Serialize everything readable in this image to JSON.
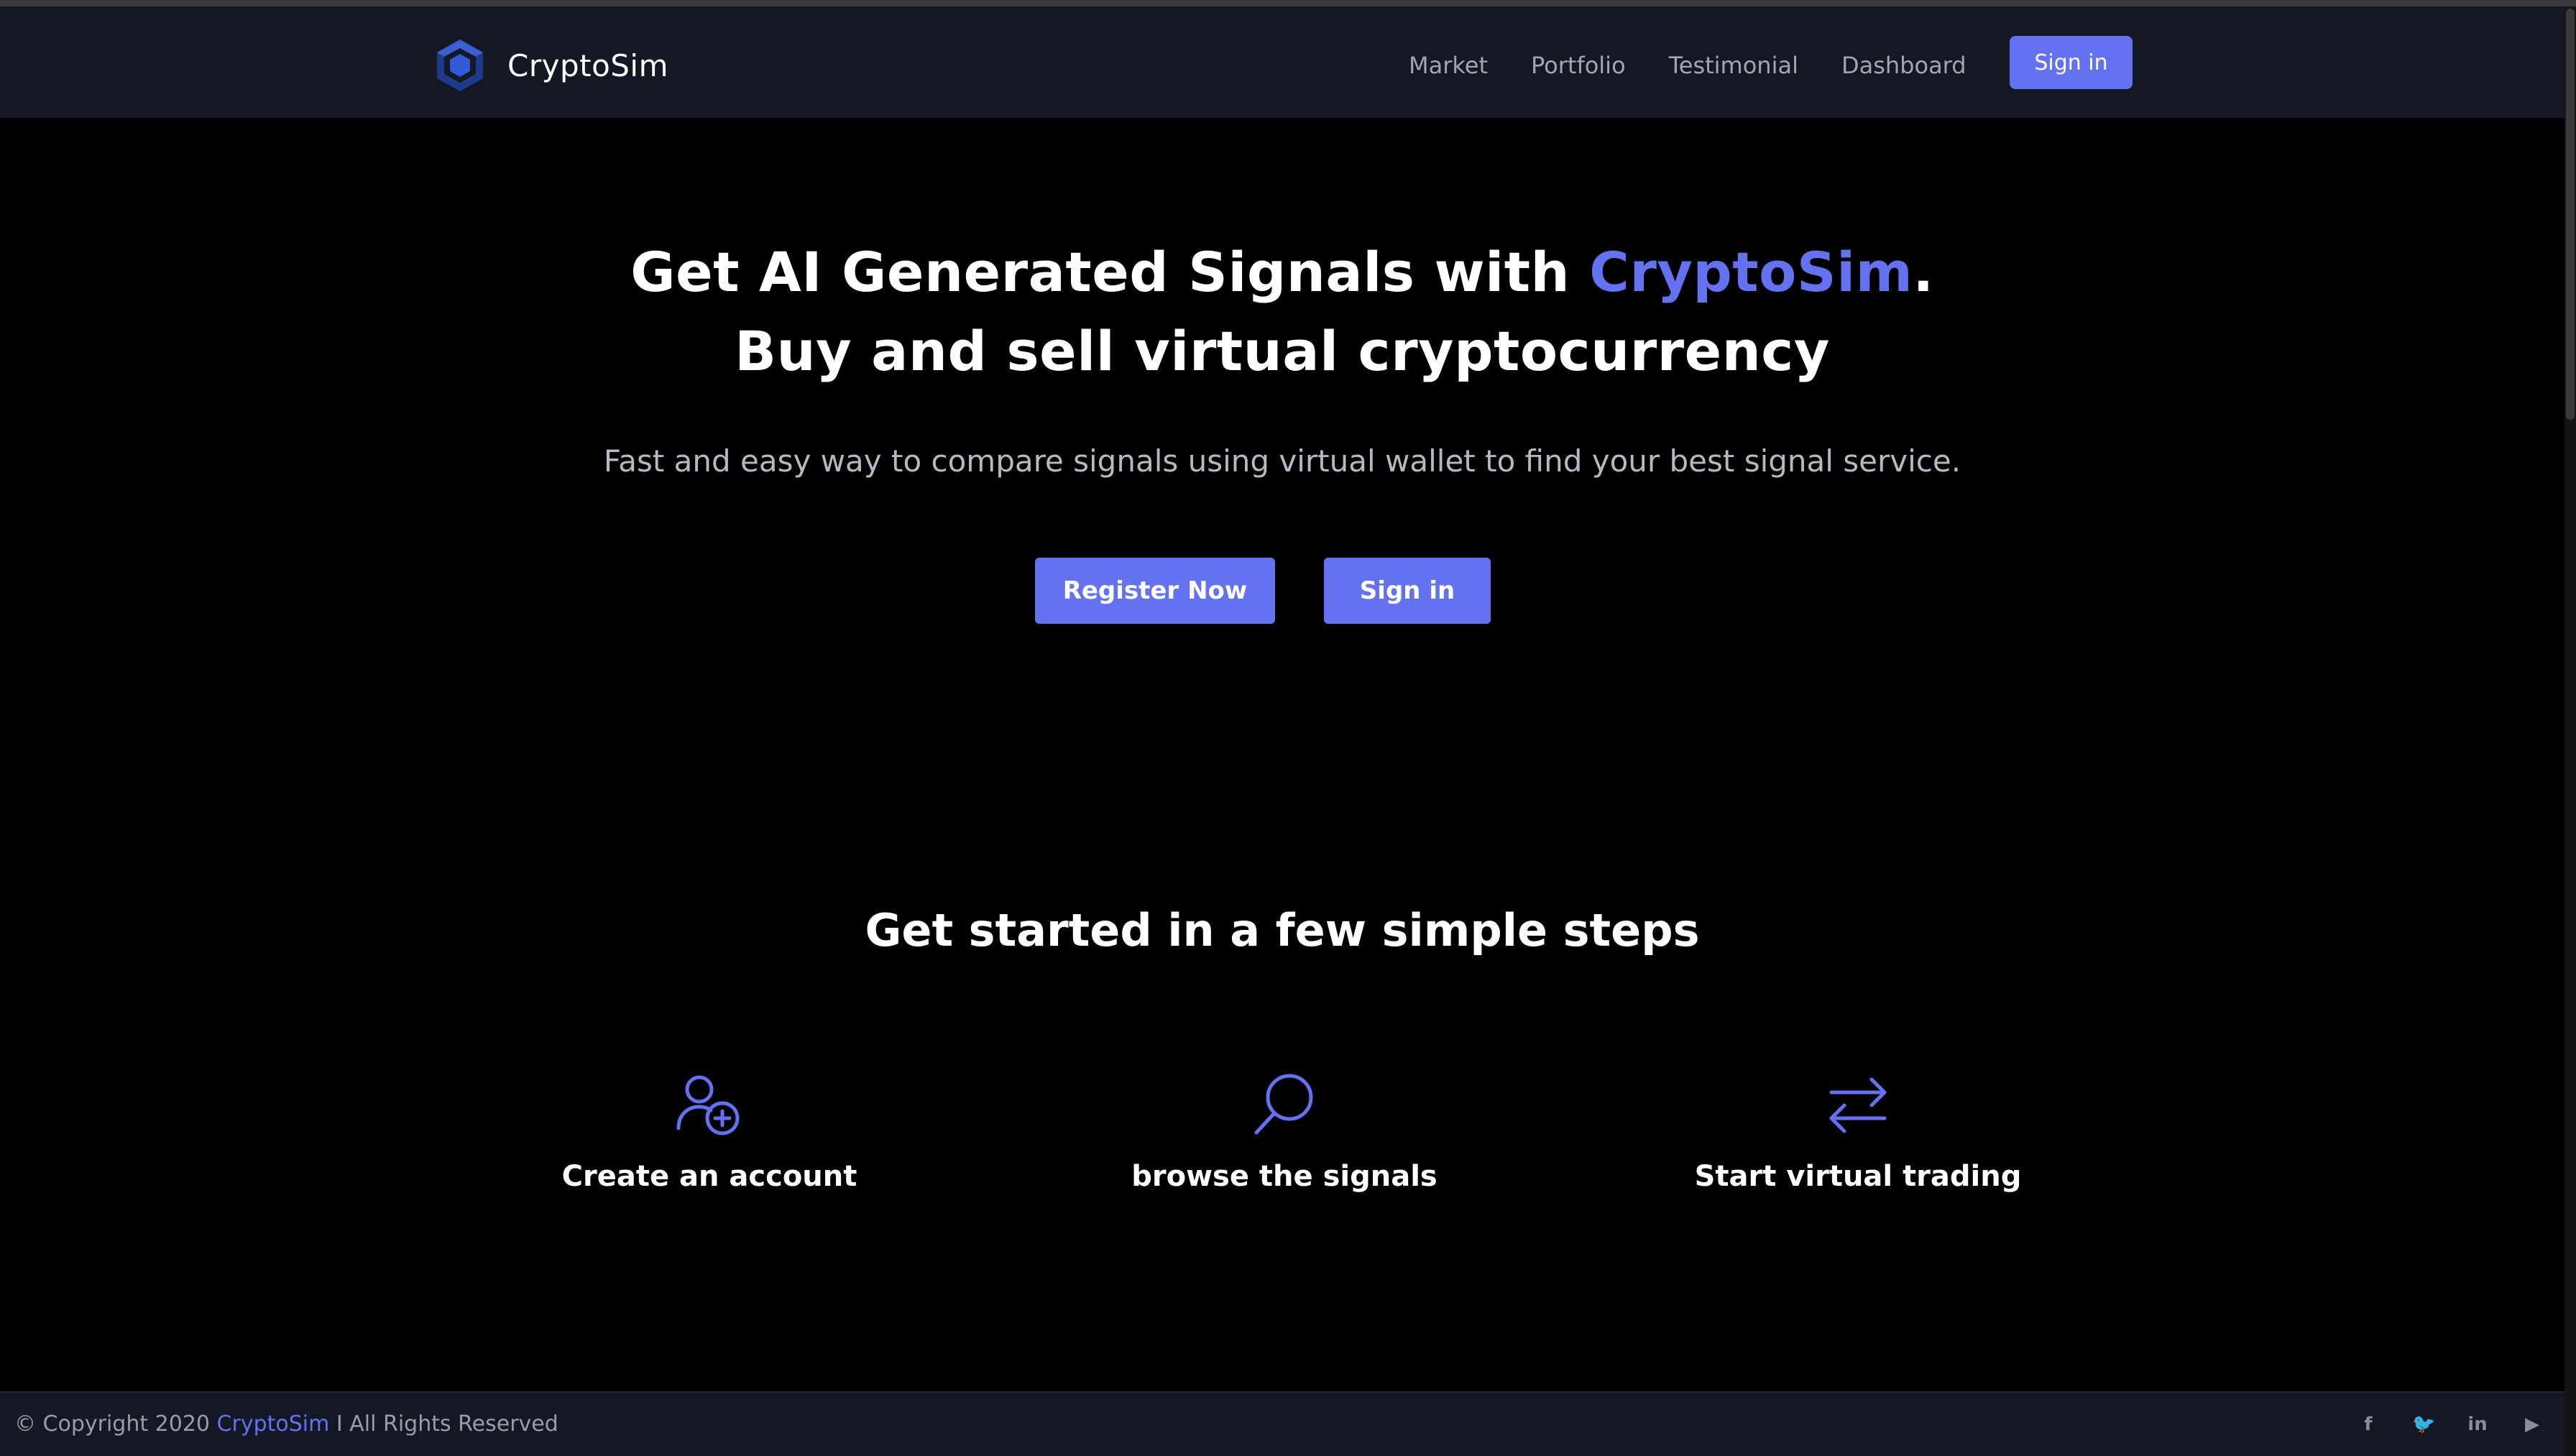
{
  "brand": {
    "name": "CryptoSim",
    "logo_icon": "hexagon-logo-icon",
    "accent_color": "#6472f2"
  },
  "nav": {
    "links": [
      "Market",
      "Portfolio",
      "Testimonial",
      "Dashboard"
    ],
    "signin_label": "Sign in"
  },
  "hero": {
    "title_part1": "Get AI Generated Signals with ",
    "title_accent": "CryptoSim",
    "title_part2": ".",
    "title_line2": "Buy and sell virtual cryptocurrency",
    "subtitle": "Fast and easy way to compare signals using virtual wallet to find your best signal service.",
    "register_label": "Register Now",
    "signin_label": "Sign in"
  },
  "steps": {
    "title": "Get started in a few simple steps",
    "items": [
      {
        "icon": "add-user-icon",
        "label": "Create an account"
      },
      {
        "icon": "search-icon",
        "label": "browse the signals"
      },
      {
        "icon": "exchange-arrows-icon",
        "label": "Start virtual trading"
      }
    ]
  },
  "footer": {
    "copyright_prefix": "© Copyright 2020 ",
    "copyright_brand": "CryptoSim",
    "copyright_suffix": " I All Rights Reserved",
    "socials": [
      {
        "icon": "facebook-icon",
        "glyph": "f"
      },
      {
        "icon": "twitter-icon",
        "glyph": "🐦"
      },
      {
        "icon": "linkedin-icon",
        "glyph": "in"
      },
      {
        "icon": "youtube-icon",
        "glyph": "▶"
      }
    ]
  }
}
